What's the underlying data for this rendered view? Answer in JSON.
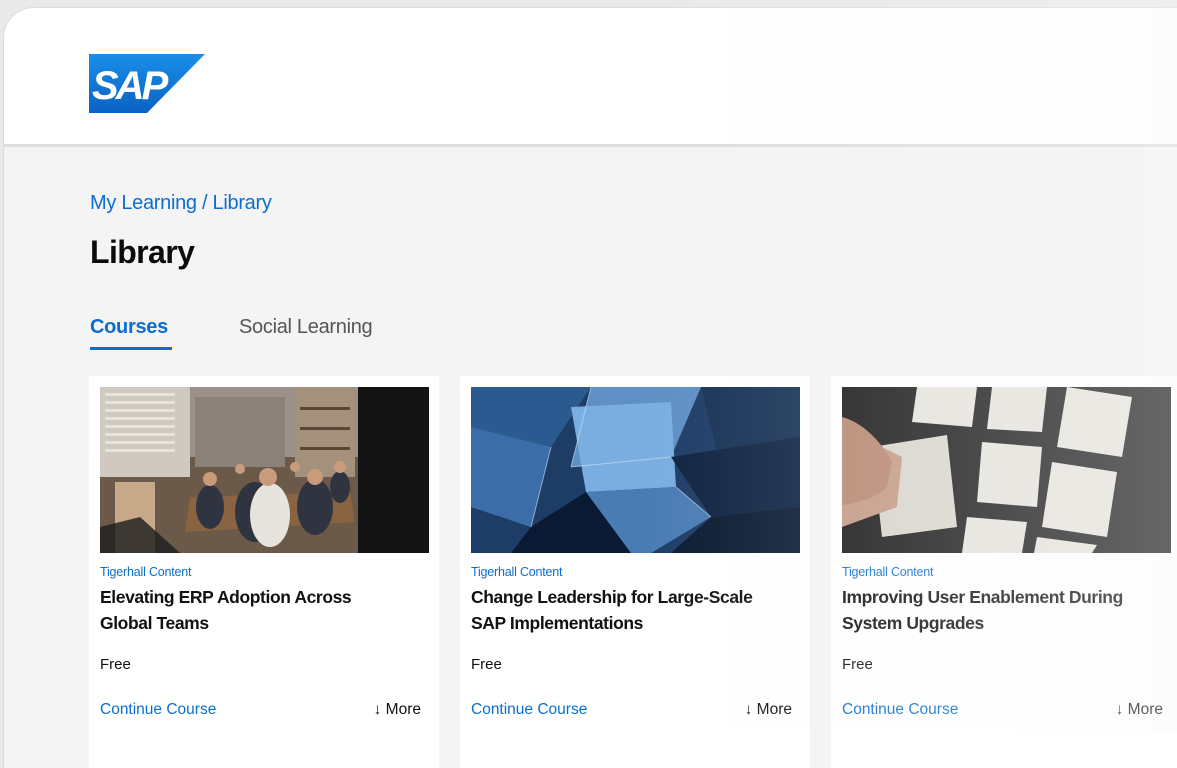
{
  "brand": {
    "logo_text": "SAP",
    "logo_color": "#0a6ed1"
  },
  "breadcrumb": "My Learning / Library",
  "page_title": "Library",
  "tabs": [
    {
      "label": "Courses",
      "active": true
    },
    {
      "label": "Social Learning",
      "active": false
    }
  ],
  "cards": [
    {
      "source": "Tigerhall Content",
      "title": "Elevating ERP Adoption Across Global Teams",
      "price": "Free",
      "action": "Continue Course",
      "more": "↓ More",
      "image": "team-meeting-photo"
    },
    {
      "source": "Tigerhall Content",
      "title": "Change Leadership for Large-Scale SAP Implementations",
      "price": "Free",
      "action": "Continue Course",
      "more": "↓ More",
      "image": "glass-architecture-photo"
    },
    {
      "source": "Tigerhall Content",
      "title": "Improving User Enablement During System Upgrades",
      "price": "Free",
      "action": "Continue Course",
      "more": "↓ More",
      "image": "sticky-notes-photo"
    }
  ],
  "colors": {
    "accent": "#0a6ed1",
    "text": "#111111",
    "background": "#f4f4f4"
  }
}
